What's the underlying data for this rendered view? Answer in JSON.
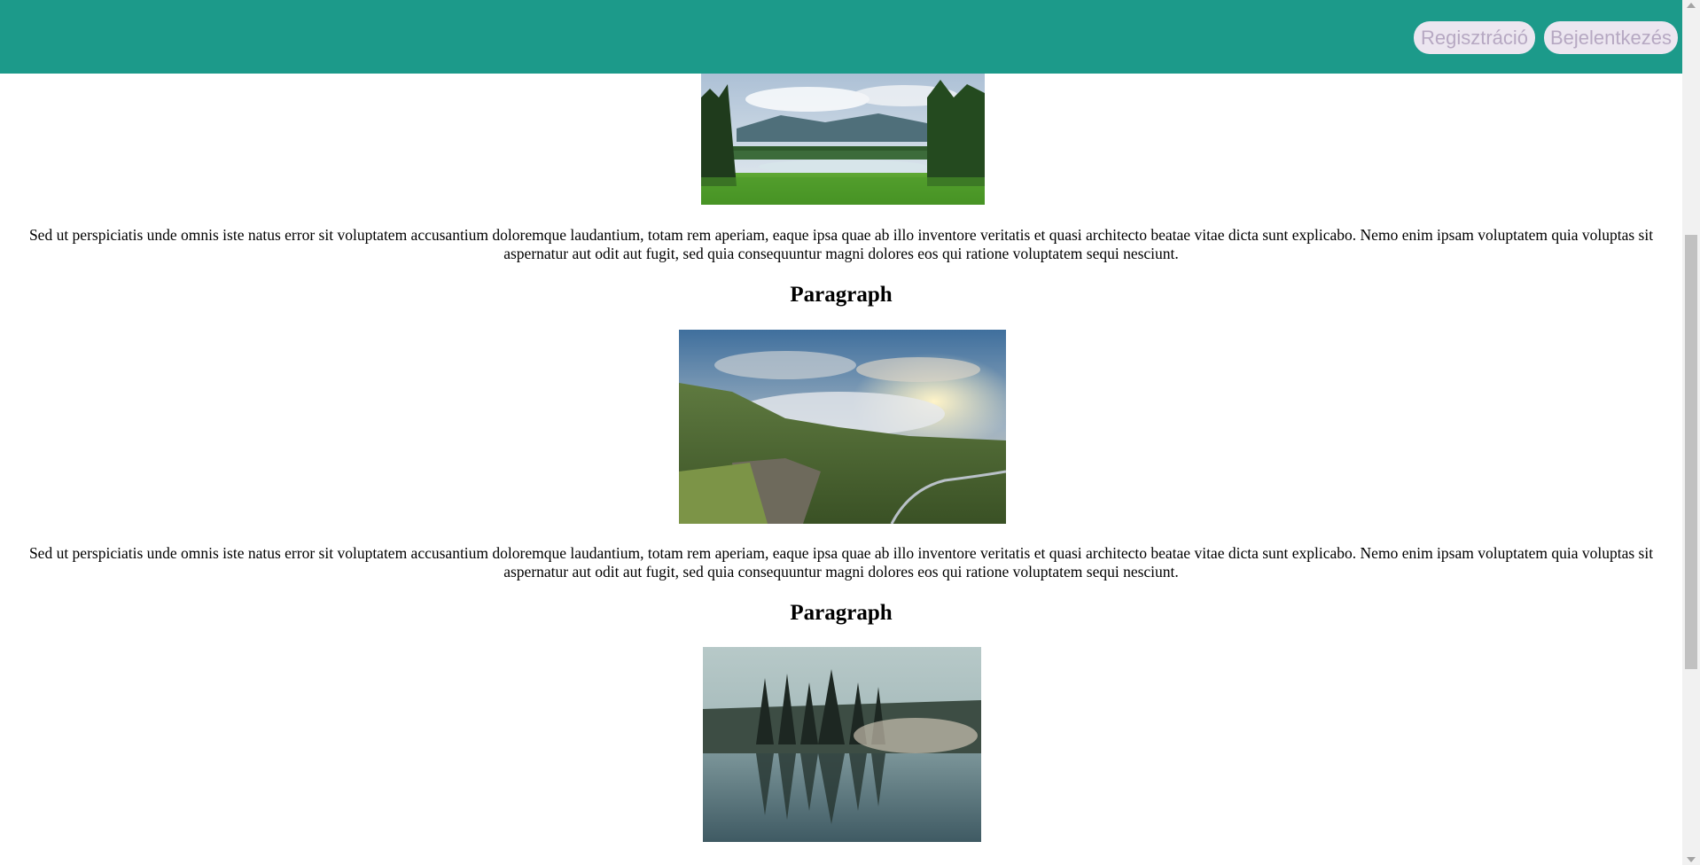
{
  "header": {
    "register_label": "Regisztráció",
    "login_label": "Bejelentkezés",
    "background_color": "#1c9a8a"
  },
  "sections": [
    {
      "image_icon": "lake-meadow-image",
      "paragraph": "Sed ut perspiciatis unde omnis iste natus error sit voluptatem accusantium doloremque laudantium, totam rem aperiam, eaque ipsa quae ab illo inventore veritatis et quasi architecto beatae vitae dicta sunt explicabo. Nemo enim ipsam voluptatem quia voluptas sit aspernatur aut odit aut fugit, sed quia consequuntur magni dolores eos qui ratione voluptatem sequi nesciunt."
    },
    {
      "heading": "Paragraph",
      "image_icon": "misty-valley-image",
      "paragraph": "Sed ut perspiciatis unde omnis iste natus error sit voluptatem accusantium doloremque laudantium, totam rem aperiam, eaque ipsa quae ab illo inventore veritatis et quasi architecto beatae vitae dicta sunt explicabo. Nemo enim ipsam voluptatem quia voluptas sit aspernatur aut odit aut fugit, sed quia consequuntur magni dolores eos qui ratione voluptatem sequi nesciunt."
    },
    {
      "heading": "Paragraph",
      "image_icon": "forest-lake-reflection-image"
    }
  ]
}
